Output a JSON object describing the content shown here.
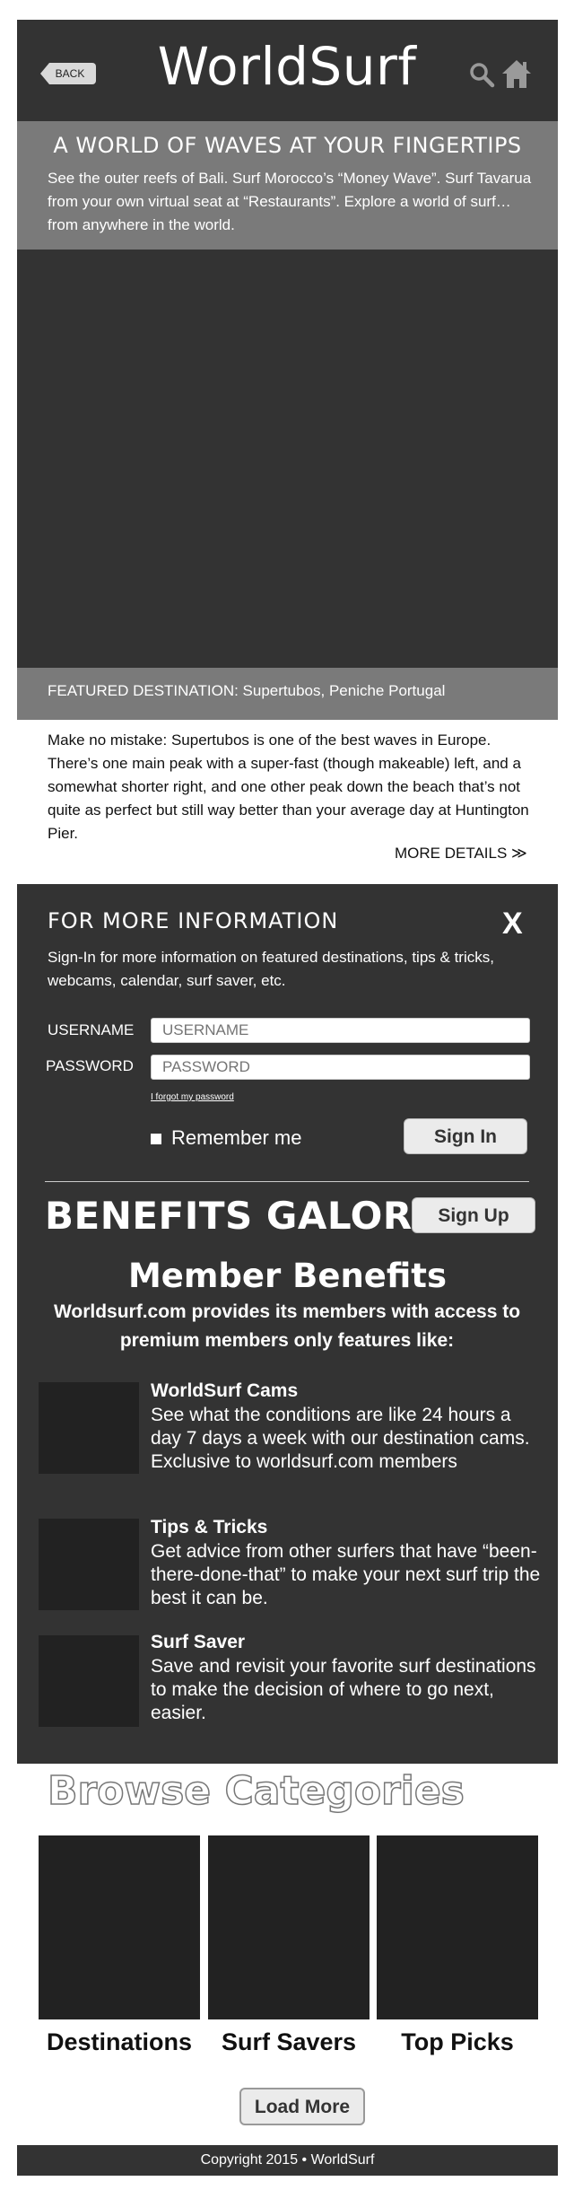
{
  "header": {
    "back_label": "BACK",
    "site_title": "WorldSurf",
    "icons": [
      "search-icon",
      "home-icon"
    ]
  },
  "hero": {
    "headline": "A WORLD OF WAVES AT YOUR FINGERTIPS",
    "description": "See the outer reefs of Bali. Surf Morocco’s “Money Wave”. Surf Tavarua from your own virtual seat at “Restaurants”. Explore a world of surf… from anywhere in the world."
  },
  "featured": {
    "label": "FEATURED DESTINATION: Supertubos, Peniche Portugal",
    "description": "Make no mistake: Supertubos is one of the best waves in Europe. There’s one main peak with a super-fast (though makeable) left, and a somewhat shorter right, and one other peak down the beach that’s not quite as perfect but still way better than your average day at Huntington Pier.",
    "more_details": "MORE DETAILS ≫"
  },
  "info": {
    "title": "FOR MORE INFORMATION",
    "close_label": "X",
    "description": "Sign-In for more information on featured destinations, tips & tricks, webcams, calendar, surf saver, etc.",
    "username_label": "USERNAME",
    "username_placeholder": "USERNAME",
    "password_label": "PASSWORD",
    "password_placeholder": "PASSWORD",
    "forgot_password": "I forgot my password",
    "remember_me": "Remember me",
    "sign_in": "Sign In"
  },
  "benefits": {
    "title": "BENEFITS GALORE",
    "sign_up": "Sign Up",
    "member_title": "Member Benefits",
    "intro": "Worldsurf.com provides its members with access to premium members only features like:",
    "items": [
      {
        "title": "WorldSurf Cams",
        "description": "See what the conditions are like 24 hours a day 7 days a week with our destination cams. Exclusive to worldsurf.com members"
      },
      {
        "title": "Tips & Tricks",
        "description": "Get advice from other surfers that have “been-there-done-that” to make your next surf trip the best it can be."
      },
      {
        "title": "Surf Saver",
        "description": "Save and revisit your favorite surf destinations to make the decision of where to go next, easier."
      }
    ]
  },
  "browse": {
    "title": "Browse Categories",
    "categories": [
      "Destinations",
      "Surf Savers",
      "Top Picks"
    ],
    "load_more": "Load More"
  },
  "footer": {
    "copyright": "Copyright 2015 • WorldSurf"
  },
  "colors": {
    "dark_panel": "#333333",
    "gray_band": "#7a7a7a",
    "tile": "#222222",
    "button_bg": "#ebebeb"
  }
}
